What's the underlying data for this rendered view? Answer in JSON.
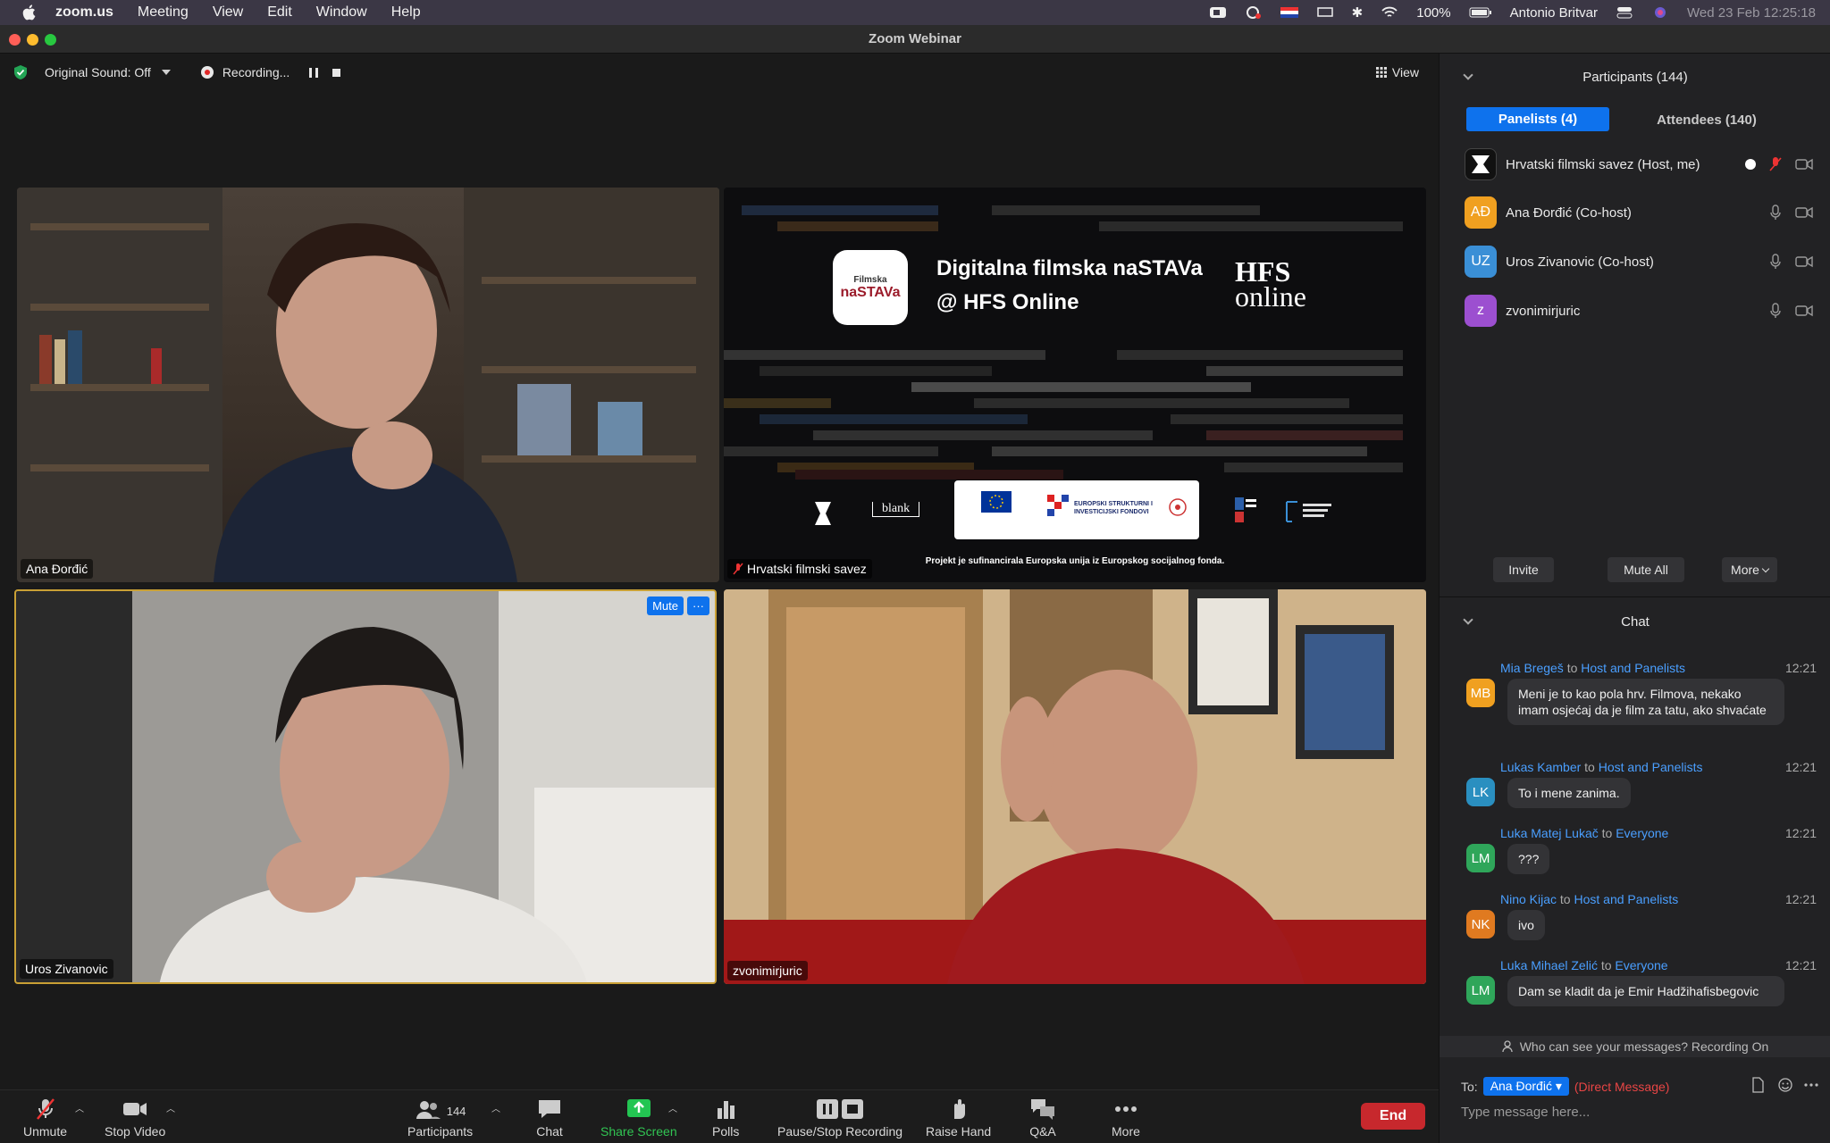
{
  "menubar": {
    "app": "zoom.us",
    "items": [
      "Meeting",
      "View",
      "Edit",
      "Window",
      "Help"
    ],
    "battery": "100%",
    "user": "Antonio Britvar",
    "clock": "Wed 23 Feb  12:25:18"
  },
  "window": {
    "title": "Zoom Webinar"
  },
  "toolbar": {
    "original_sound": "Original Sound: Off",
    "recording": "Recording...",
    "view": "View"
  },
  "tiles": {
    "ana": "Ana Đorđić",
    "hfs": "Hrvatski filmski savez",
    "uros": "Uros Zivanovic",
    "zvonimir": "zvonimirjuric",
    "mute_btn": "Mute",
    "more_btn": "···"
  },
  "slide": {
    "logo_small": "Filmska",
    "logo_big": "naSTAVa",
    "title_line1": "Digitalna filmska naSTAVa",
    "title_line2": "@ HFS Online",
    "hfs_line1": "HFS",
    "hfs_line2": "online",
    "blank": "blank",
    "sponsor_text": "EUROPSKI STRUKTURNI I INVESTICIJSKI FONDOVI",
    "footer": "Projekt je sufinancirala Europska unija iz Europskog socijalnog fonda."
  },
  "controls": {
    "unmute": "Unmute",
    "stop_video": "Stop Video",
    "participants": "Participants",
    "participant_count": "144",
    "chat": "Chat",
    "share_screen": "Share Screen",
    "polls": "Polls",
    "pause_stop_recording": "Pause/Stop Recording",
    "raise_hand": "Raise Hand",
    "qa": "Q&A",
    "more": "More",
    "end": "End"
  },
  "participants_panel": {
    "title": "Participants (144)",
    "tab_panelists": "Panelists (4)",
    "tab_attendees": "Attendees (140)",
    "rows": [
      {
        "name": "Hrvatski filmski savez (Host, me)",
        "initials": "",
        "color": "#111111"
      },
      {
        "name": "Ana Đorđić (Co-host)",
        "initials": "AĐ",
        "color": "#f0a020"
      },
      {
        "name": "Uros Zivanovic (Co-host)",
        "initials": "UZ",
        "color": "#3a8fd6"
      },
      {
        "name": "zvonimirjuric",
        "initials": "z",
        "color": "#9c4fd0"
      }
    ],
    "invite": "Invite",
    "mute_all": "Mute All",
    "more": "More"
  },
  "chat_panel": {
    "title": "Chat",
    "messages": [
      {
        "from": "Mia Bregeš",
        "to": "Host and Panelists",
        "time": "12:21",
        "initials": "MB",
        "color": "#f0a020",
        "text": "Meni je to kao pola hrv. Filmova, nekako imam osjećaj da je film za tatu, ako shvaćate"
      },
      {
        "from": "Lukas Kamber",
        "to": "Host and Panelists",
        "time": "12:21",
        "initials": "LK",
        "color": "#2a8fc0",
        "text": "To i mene zanima."
      },
      {
        "from": "Luka Matej Lukač",
        "to": "Everyone",
        "time": "12:21",
        "initials": "LM",
        "color": "#2fa65a",
        "text": "???"
      },
      {
        "from": "Nino Kijac",
        "to": "Host and Panelists",
        "time": "12:21",
        "initials": "NK",
        "color": "#e07a20",
        "text": "ivo"
      },
      {
        "from": "Luka Mihael Zelić",
        "to": "Everyone",
        "time": "12:21",
        "initials": "LM",
        "color": "#2fa65a",
        "text": "Dam se kladit da je Emir Hadžihafisbegovic"
      }
    ],
    "to_word": "to",
    "notice": "Who can see your messages? Recording On",
    "to_label": "To:",
    "recipient": "Ana Đorđić",
    "dm_label": "(Direct Message)",
    "placeholder": "Type message here..."
  }
}
